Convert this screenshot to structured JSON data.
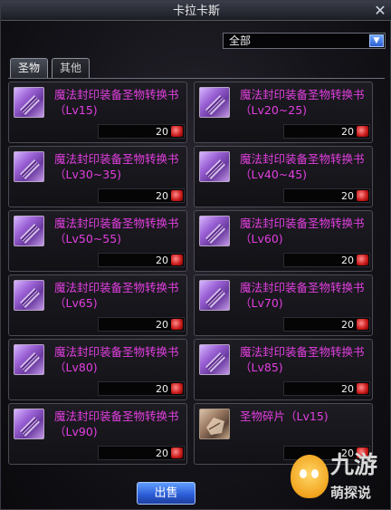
{
  "window": {
    "title": "卡拉卡斯",
    "close": "✕"
  },
  "filter": {
    "value": "全部",
    "arrow": "▼"
  },
  "tabs": [
    {
      "label": "圣物",
      "active": true
    },
    {
      "label": "其他",
      "active": false
    }
  ],
  "items": [
    {
      "name": "魔法封印装备圣物转换书（Lv15)",
      "price": "20",
      "icon": "scroll-icon"
    },
    {
      "name": "魔法封印装备圣物转换书（Lv20~25)",
      "price": "20",
      "icon": "scroll-icon"
    },
    {
      "name": "魔法封印装备圣物转换书（Lv30~35)",
      "price": "20",
      "icon": "scroll-icon"
    },
    {
      "name": "魔法封印装备圣物转换书（Lv40~45)",
      "price": "20",
      "icon": "scroll-icon"
    },
    {
      "name": "魔法封印装备圣物转换书（Lv50~55)",
      "price": "20",
      "icon": "scroll-icon"
    },
    {
      "name": "魔法封印装备圣物转换书（Lv60)",
      "price": "20",
      "icon": "scroll-icon"
    },
    {
      "name": "魔法封印装备圣物转换书（Lv65)",
      "price": "20",
      "icon": "scroll-icon"
    },
    {
      "name": "魔法封印装备圣物转换书（Lv70)",
      "price": "20",
      "icon": "scroll-icon"
    },
    {
      "name": "魔法封印装备圣物转换书（Lv80)",
      "price": "20",
      "icon": "scroll-icon"
    },
    {
      "name": "魔法封印装备圣物转换书（Lv85)",
      "price": "20",
      "icon": "scroll-icon"
    },
    {
      "name": "魔法封印装备圣物转换书（Lv90)",
      "price": "20",
      "icon": "scroll-icon"
    },
    {
      "name": "圣物碎片（Lv15)",
      "price": "20",
      "icon": "fragment-icon"
    }
  ],
  "sell_button": "出售",
  "watermark": {
    "big": "九游",
    "small": "萌探说"
  },
  "colors": {
    "item_name": "#e23fe0",
    "currency_gem": "#c81818",
    "button": "#2a5ad4"
  }
}
